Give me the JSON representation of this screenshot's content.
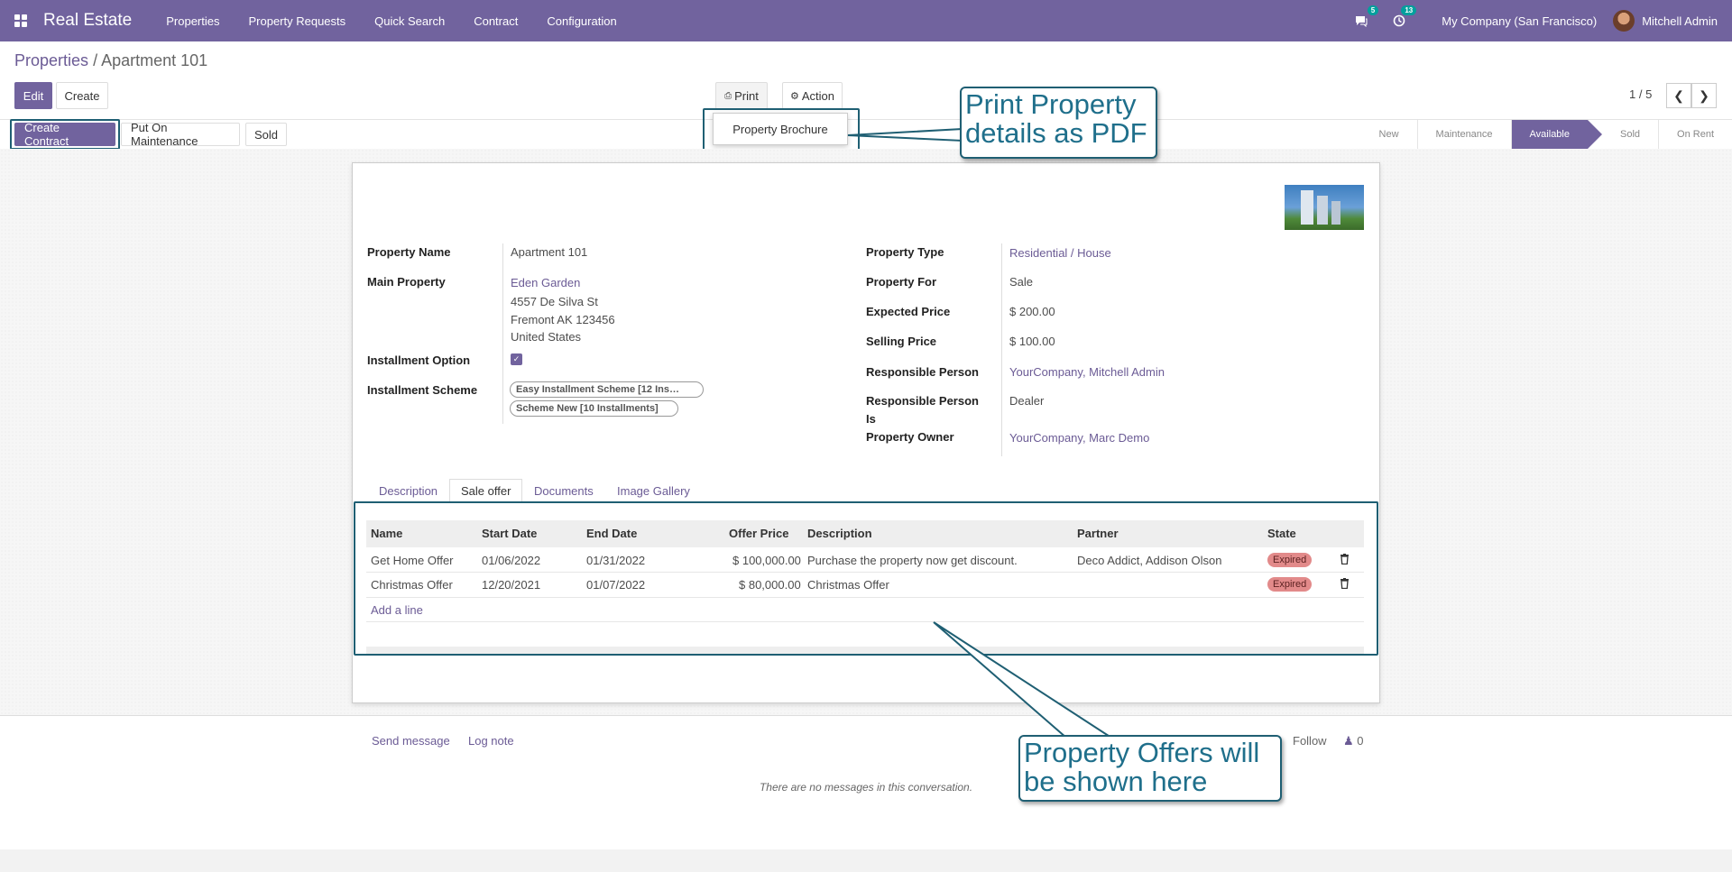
{
  "navbar": {
    "app_name": "Real Estate",
    "menu": [
      "Properties",
      "Property Requests",
      "Quick Search",
      "Contract",
      "Configuration"
    ],
    "messages_count": "5",
    "activities_count": "13",
    "company": "My Company (San Francisco)",
    "user": "Mitchell Admin"
  },
  "breadcrumb": {
    "parent": "Properties",
    "separator": "/",
    "current": "Apartment 101"
  },
  "toolbar": {
    "edit": "Edit",
    "create": "Create",
    "print": "Print",
    "action": "Action",
    "pager": "1 / 5"
  },
  "print_dropdown": {
    "item": "Property Brochure"
  },
  "header_buttons": {
    "create_contract": "Create Contract",
    "maintenance": "Put On Maintenance",
    "sold": "Sold"
  },
  "status": {
    "stages": [
      "New",
      "Maintenance",
      "Available",
      "Sold",
      "On Rent"
    ],
    "active": "Available"
  },
  "form": {
    "property_name_label": "Property Name",
    "property_name": "Apartment 101",
    "main_property_label": "Main Property",
    "main_property": "Eden Garden",
    "address_line1": "4557 De Silva St",
    "address_line2": "Fremont AK 123456",
    "address_line3": "United States",
    "installment_option_label": "Installment Option",
    "installment_option": true,
    "installment_scheme_label": "Installment Scheme",
    "installment_schemes": [
      "Easy Installment Scheme [12 Ins…",
      "Scheme New [10 Installments]"
    ],
    "property_type_label": "Property Type",
    "property_type": "Residential / House",
    "property_for_label": "Property For",
    "property_for": "Sale",
    "expected_price_label": "Expected Price",
    "expected_price": "$ 200.00",
    "selling_price_label": "Selling Price",
    "selling_price": "$ 100.00",
    "responsible_person_label": "Responsible Person",
    "responsible_person": "YourCompany, Mitchell Admin",
    "responsible_person_is_label_1": "Responsible Person",
    "responsible_person_is_label_2": "Is",
    "responsible_person_is": "Dealer",
    "property_owner_label": "Property Owner",
    "property_owner": "YourCompany, Marc Demo"
  },
  "tabs": [
    "Description",
    "Sale offer",
    "Documents",
    "Image Gallery"
  ],
  "active_tab": "Sale offer",
  "offers_table": {
    "columns": [
      "Name",
      "Start Date",
      "End Date",
      "Offer Price",
      "Description",
      "Partner",
      "State"
    ],
    "rows": [
      {
        "name": "Get Home Offer",
        "start": "01/06/2022",
        "end": "01/31/2022",
        "price": "$ 100,000.00",
        "description": "Purchase the property now get discount.",
        "partner": "Deco Addict, Addison Olson",
        "state": "Expired"
      },
      {
        "name": "Christmas Offer",
        "start": "12/20/2021",
        "end": "01/07/2022",
        "price": "$ 80,000.00",
        "description": "Christmas Offer",
        "partner": "",
        "state": "Expired"
      }
    ],
    "add_line": "Add a line"
  },
  "chatter": {
    "send_message": "Send message",
    "log_note": "Log note",
    "follow": "Follow",
    "followers": "0",
    "no_messages": "There are no messages in this conversation."
  },
  "callouts": {
    "print_line1": "Print Property",
    "print_line2": "details as PDF",
    "offers_line1": "Property Offers will",
    "offers_line2": "be shown here"
  },
  "colors": {
    "brand": "#71639e",
    "callout_border": "#1f5f73",
    "callout_text": "#1f6f8b",
    "expired_badge": "#e28a8a"
  }
}
